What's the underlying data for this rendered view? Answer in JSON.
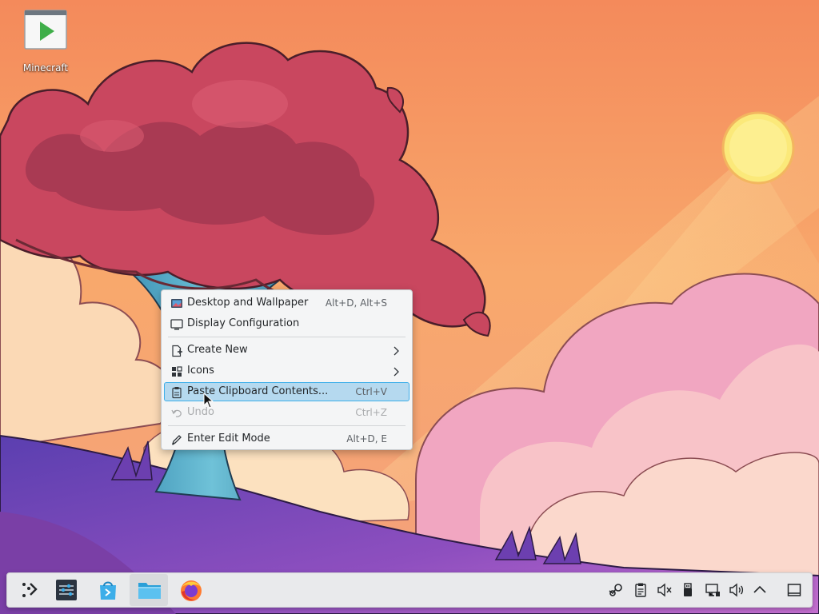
{
  "desktop": {
    "icons": [
      {
        "label": "Minecraft",
        "icon": "minecraft-launcher-icon"
      }
    ]
  },
  "context_menu": {
    "items": [
      {
        "label": "Desktop and Wallpaper",
        "shortcut": "Alt+D, Alt+S",
        "icon": "wallpaper-icon"
      },
      {
        "label": "Display Configuration",
        "shortcut": "",
        "icon": "display-icon"
      },
      {
        "label": "Create New",
        "shortcut": "",
        "icon": "new-document-icon",
        "submenu": true
      },
      {
        "label": "Icons",
        "shortcut": "",
        "icon": "icons-grid-icon",
        "submenu": true
      },
      {
        "label": "Paste Clipboard Contents...",
        "shortcut": "Ctrl+V",
        "icon": "clipboard-icon",
        "highlighted": true
      },
      {
        "label": "Undo",
        "shortcut": "Ctrl+Z",
        "icon": "undo-icon",
        "disabled": true
      },
      {
        "label": "Enter Edit Mode",
        "shortcut": "Alt+D, E",
        "icon": "edit-icon"
      }
    ]
  },
  "taskbar": {
    "apps": [
      {
        "name": "application-launcher",
        "icon": "launcher-icon"
      },
      {
        "name": "system-settings",
        "icon": "settings-icon"
      },
      {
        "name": "discover",
        "icon": "discover-store-icon"
      },
      {
        "name": "dolphin",
        "icon": "folder-icon",
        "active": true
      },
      {
        "name": "firefox",
        "icon": "firefox-icon"
      }
    ],
    "tray": [
      "steam-icon",
      "clipboard-icon",
      "audio-muted-icon",
      "usb-device-icon",
      "network-wired-icon",
      "volume-icon",
      "tray-expand-icon",
      "show-desktop-icon"
    ]
  },
  "colors": {
    "highlight_bg": "#b5d9ef",
    "highlight_border": "#3daee9",
    "menu_bg": "#f4f5f6",
    "panel_bg": "#e9eaec"
  }
}
